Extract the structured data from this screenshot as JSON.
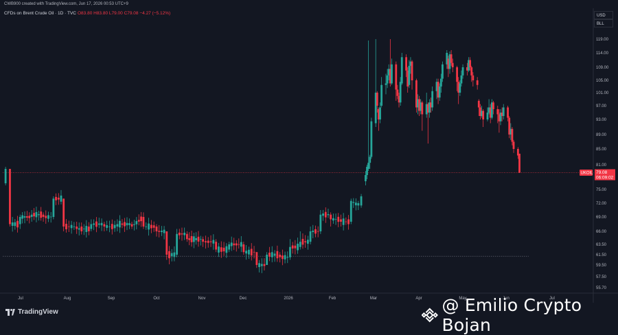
{
  "header": {
    "created_by": "CWB900 created with TradingView.com, Jun 17, 2026 00:53 UTC+9"
  },
  "legend": {
    "symbol": "CFDs on Brent Crude Oil · 1D · TVC",
    "ohlc_text": "O83.80 H83.80 L79.00 C79.08 −4.27 (−5.12%)"
  },
  "price_axis": {
    "currency": "USD",
    "unit": "BLL",
    "last_label": "UKOIL",
    "last_price": "79.08",
    "countdown": "06:09:02"
  },
  "footer": {
    "brand": "TradingView",
    "watermark": "@ Emilio Crypto Bojan"
  },
  "colors": {
    "background": "#131722",
    "up": "#26a69a",
    "down": "#f23645",
    "price_line": "#f23645"
  },
  "chart_data": {
    "type": "candlestick",
    "title": "CFDs on Brent Crude Oil · 1D · TVC",
    "y_ticks": [
      "119.00",
      "114.00",
      "109.00",
      "105.00",
      "101.00",
      "97.00",
      "93.00",
      "89.00",
      "85.00",
      "81.00",
      "75.00",
      "72.00",
      "69.00",
      "66.00",
      "63.50",
      "61.50",
      "59.50",
      "57.50",
      "55.70"
    ],
    "x_ticks": [
      "Jul",
      "Aug",
      "Sep",
      "Oct",
      "Nov",
      "Dec",
      "2026",
      "Feb",
      "Mar",
      "Apr",
      "May",
      "Jun",
      "Jul"
    ],
    "ylim": [
      55.7,
      119
    ],
    "horizontal_line": 61.2,
    "last_price": 79.08,
    "grid": false,
    "candles": [
      {
        "d": "2025-06-27",
        "c": 80.0,
        "o": 76.5,
        "h": 80.5,
        "l": 76.0
      },
      {
        "d": "2025-06-30",
        "c": 67.5,
        "o": 80.0,
        "h": 80.0,
        "l": 67.0
      },
      {
        "d": "2025-07-07",
        "c": 69.0,
        "o": 67.5,
        "h": 69.5,
        "l": 66.5
      },
      {
        "d": "2025-07-15",
        "c": 69.5,
        "o": 69.0,
        "h": 70.5,
        "l": 68.0
      },
      {
        "d": "2025-07-23",
        "c": 69.0,
        "o": 69.5,
        "h": 70.0,
        "l": 68.0
      },
      {
        "d": "2025-07-30",
        "c": 73.0,
        "o": 69.0,
        "h": 73.5,
        "l": 68.5
      },
      {
        "d": "2025-08-06",
        "c": 67.0,
        "o": 73.0,
        "h": 73.0,
        "l": 66.0
      },
      {
        "d": "2025-08-15",
        "c": 66.5,
        "o": 67.0,
        "h": 68.0,
        "l": 65.5
      },
      {
        "d": "2025-08-25",
        "c": 67.5,
        "o": 66.5,
        "h": 68.5,
        "l": 66.0
      },
      {
        "d": "2025-09-03",
        "c": 67.0,
        "o": 67.5,
        "h": 68.0,
        "l": 66.0
      },
      {
        "d": "2025-09-12",
        "c": 67.5,
        "o": 67.0,
        "h": 68.5,
        "l": 66.0
      },
      {
        "d": "2025-09-22",
        "c": 67.0,
        "o": 67.5,
        "h": 68.0,
        "l": 66.5
      },
      {
        "d": "2025-09-30",
        "c": 67.0,
        "o": 69.0,
        "h": 70.0,
        "l": 66.5
      },
      {
        "d": "2025-10-09",
        "c": 66.0,
        "o": 67.0,
        "h": 67.5,
        "l": 65.0
      },
      {
        "d": "2025-10-16",
        "c": 61.5,
        "o": 66.0,
        "h": 66.0,
        "l": 60.5
      },
      {
        "d": "2025-10-23",
        "c": 65.5,
        "o": 61.5,
        "h": 66.5,
        "l": 61.0
      },
      {
        "d": "2025-10-30",
        "c": 64.5,
        "o": 65.5,
        "h": 66.0,
        "l": 64.0
      },
      {
        "d": "2025-11-10",
        "c": 64.0,
        "o": 64.5,
        "h": 65.0,
        "l": 63.0
      },
      {
        "d": "2025-11-19",
        "c": 62.5,
        "o": 64.0,
        "h": 64.5,
        "l": 62.0
      },
      {
        "d": "2025-11-28",
        "c": 63.5,
        "o": 62.5,
        "h": 64.0,
        "l": 62.0
      },
      {
        "d": "2025-12-08",
        "c": 62.0,
        "o": 63.5,
        "h": 64.0,
        "l": 61.5
      },
      {
        "d": "2025-12-17",
        "c": 59.5,
        "o": 62.0,
        "h": 62.0,
        "l": 59.0
      },
      {
        "d": "2025-12-24",
        "c": 61.5,
        "o": 59.5,
        "h": 62.0,
        "l": 59.5
      },
      {
        "d": "2026-01-02",
        "c": 61.0,
        "o": 61.5,
        "h": 62.0,
        "l": 60.0
      },
      {
        "d": "2026-01-09",
        "c": 63.0,
        "o": 61.0,
        "h": 64.5,
        "l": 60.5
      },
      {
        "d": "2026-01-16",
        "c": 64.0,
        "o": 63.0,
        "h": 66.0,
        "l": 62.5
      },
      {
        "d": "2026-01-23",
        "c": 66.0,
        "o": 64.0,
        "h": 67.0,
        "l": 63.5
      },
      {
        "d": "2026-01-30",
        "c": 69.5,
        "o": 66.0,
        "h": 70.5,
        "l": 65.5
      },
      {
        "d": "2026-02-06",
        "c": 68.5,
        "o": 69.5,
        "h": 70.0,
        "l": 67.0
      },
      {
        "d": "2026-02-13",
        "c": 68.0,
        "o": 68.5,
        "h": 69.5,
        "l": 67.0
      },
      {
        "d": "2026-02-20",
        "c": 72.5,
        "o": 68.0,
        "h": 73.0,
        "l": 67.5
      },
      {
        "d": "2026-02-25",
        "c": 72.0,
        "o": 71.5,
        "h": 72.5,
        "l": 70.5
      },
      {
        "d": "2026-02-27",
        "c": 73.5,
        "o": 71.5,
        "h": 74.0,
        "l": 71.0
      },
      {
        "d": "2026-03-02",
        "c": 78.5,
        "o": 77.0,
        "h": 79.5,
        "l": 76.0
      },
      {
        "d": "2026-03-03",
        "c": 80.5,
        "o": 78.5,
        "h": 81.0,
        "l": 77.5
      },
      {
        "d": "2026-03-04",
        "c": 81.5,
        "o": 80.0,
        "h": 118.5,
        "l": 79.5
      },
      {
        "d": "2026-03-05",
        "c": 83.0,
        "o": 81.5,
        "h": 83.5,
        "l": 80.0
      },
      {
        "d": "2026-03-06",
        "c": 92.5,
        "o": 83.0,
        "h": 93.5,
        "l": 82.5
      },
      {
        "d": "2026-03-09",
        "c": 101.0,
        "o": 92.0,
        "h": 119.0,
        "l": 91.0
      },
      {
        "d": "2026-03-10",
        "c": 97.0,
        "o": 101.0,
        "h": 101.5,
        "l": 95.0
      },
      {
        "d": "2026-03-11",
        "c": 93.0,
        "o": 96.0,
        "h": 96.5,
        "l": 90.0
      },
      {
        "d": "2026-03-12",
        "c": 96.5,
        "o": 93.0,
        "h": 98.0,
        "l": 92.0
      },
      {
        "d": "2026-03-13",
        "c": 103.5,
        "o": 97.0,
        "h": 106.0,
        "l": 96.5
      },
      {
        "d": "2026-03-16",
        "c": 104.0,
        "o": 103.5,
        "h": 107.0,
        "l": 100.5
      },
      {
        "d": "2026-03-17",
        "c": 106.5,
        "o": 104.0,
        "h": 108.5,
        "l": 102.5
      },
      {
        "d": "2026-03-18",
        "c": 108.5,
        "o": 106.5,
        "h": 110.0,
        "l": 105.0
      },
      {
        "d": "2026-03-19",
        "c": 104.0,
        "o": 108.5,
        "h": 119.0,
        "l": 103.0
      },
      {
        "d": "2026-03-20",
        "c": 110.0,
        "o": 104.0,
        "h": 112.0,
        "l": 103.5
      },
      {
        "d": "2026-03-23",
        "c": 102.0,
        "o": 110.0,
        "h": 111.0,
        "l": 98.5
      },
      {
        "d": "2026-03-24",
        "c": 100.0,
        "o": 102.0,
        "h": 103.5,
        "l": 99.0
      },
      {
        "d": "2026-03-25",
        "c": 98.0,
        "o": 100.0,
        "h": 101.0,
        "l": 96.5
      },
      {
        "d": "2026-03-26",
        "c": 104.5,
        "o": 98.0,
        "h": 106.0,
        "l": 97.0
      },
      {
        "d": "2026-03-27",
        "c": 112.5,
        "o": 104.0,
        "h": 114.0,
        "l": 103.5
      },
      {
        "d": "2026-03-30",
        "c": 108.0,
        "o": 112.5,
        "h": 113.5,
        "l": 106.0
      },
      {
        "d": "2026-03-31",
        "c": 103.0,
        "o": 108.0,
        "h": 109.0,
        "l": 101.0
      },
      {
        "d": "2026-04-01",
        "c": 109.5,
        "o": 103.5,
        "h": 111.5,
        "l": 102.5
      },
      {
        "d": "2026-04-02",
        "c": 111.0,
        "o": 109.5,
        "h": 112.5,
        "l": 107.0
      },
      {
        "d": "2026-04-03",
        "c": 105.0,
        "o": 111.0,
        "h": 111.5,
        "l": 102.0
      },
      {
        "d": "2026-04-06",
        "c": 96.5,
        "o": 105.0,
        "h": 105.5,
        "l": 95.0
      },
      {
        "d": "2026-04-07",
        "c": 99.0,
        "o": 96.5,
        "h": 100.5,
        "l": 94.5
      },
      {
        "d": "2026-04-08",
        "c": 95.5,
        "o": 99.0,
        "h": 100.0,
        "l": 94.0
      },
      {
        "d": "2026-04-09",
        "c": 98.0,
        "o": 95.5,
        "h": 99.0,
        "l": 94.5
      },
      {
        "d": "2026-04-10",
        "c": 94.5,
        "o": 98.0,
        "h": 98.5,
        "l": 90.0
      },
      {
        "d": "2026-04-13",
        "c": 97.5,
        "o": 94.5,
        "h": 101.0,
        "l": 93.5
      },
      {
        "d": "2026-04-14",
        "c": 95.0,
        "o": 97.5,
        "h": 98.0,
        "l": 86.5
      },
      {
        "d": "2026-04-15",
        "c": 98.0,
        "o": 95.0,
        "h": 99.0,
        "l": 93.5
      },
      {
        "d": "2026-04-16",
        "c": 96.5,
        "o": 98.0,
        "h": 99.5,
        "l": 95.0
      },
      {
        "d": "2026-04-17",
        "c": 101.5,
        "o": 96.5,
        "h": 103.0,
        "l": 95.5
      },
      {
        "d": "2026-04-20",
        "c": 104.5,
        "o": 101.5,
        "h": 105.5,
        "l": 99.0
      },
      {
        "d": "2026-04-21",
        "c": 99.5,
        "o": 104.5,
        "h": 105.5,
        "l": 97.5
      },
      {
        "d": "2026-04-22",
        "c": 103.0,
        "o": 99.5,
        "h": 104.0,
        "l": 98.5
      },
      {
        "d": "2026-04-23",
        "c": 105.5,
        "o": 103.0,
        "h": 107.0,
        "l": 101.0
      },
      {
        "d": "2026-04-24",
        "c": 110.0,
        "o": 105.5,
        "h": 111.0,
        "l": 104.5
      },
      {
        "d": "2026-04-27",
        "c": 114.0,
        "o": 110.0,
        "h": 115.0,
        "l": 108.5
      },
      {
        "d": "2026-04-28",
        "c": 108.5,
        "o": 112.0,
        "h": 113.0,
        "l": 106.0
      },
      {
        "d": "2026-04-29",
        "c": 113.5,
        "o": 108.5,
        "h": 114.5,
        "l": 107.0
      },
      {
        "d": "2026-04-30",
        "c": 110.5,
        "o": 113.5,
        "h": 115.0,
        "l": 109.5
      },
      {
        "d": "2026-05-01",
        "c": 109.0,
        "o": 110.5,
        "h": 112.0,
        "l": 107.5
      },
      {
        "d": "2026-05-04",
        "c": 104.5,
        "o": 109.0,
        "h": 109.5,
        "l": 101.5
      },
      {
        "d": "2026-05-05",
        "c": 101.0,
        "o": 104.5,
        "h": 106.0,
        "l": 97.5
      },
      {
        "d": "2026-05-06",
        "c": 104.0,
        "o": 101.0,
        "h": 105.0,
        "l": 100.0
      },
      {
        "d": "2026-05-07",
        "c": 106.5,
        "o": 104.0,
        "h": 108.0,
        "l": 103.0
      },
      {
        "d": "2026-05-08",
        "c": 109.0,
        "o": 106.5,
        "h": 110.0,
        "l": 105.5
      },
      {
        "d": "2026-05-11",
        "c": 108.0,
        "o": 109.0,
        "h": 110.5,
        "l": 106.5
      },
      {
        "d": "2026-05-12",
        "c": 111.5,
        "o": 108.0,
        "h": 112.5,
        "l": 107.5
      },
      {
        "d": "2026-05-13",
        "c": 109.0,
        "o": 111.5,
        "h": 112.5,
        "l": 108.0
      },
      {
        "d": "2026-05-14",
        "c": 106.5,
        "o": 109.0,
        "h": 109.5,
        "l": 104.5
      },
      {
        "d": "2026-05-15",
        "c": 105.0,
        "o": 106.5,
        "h": 107.5,
        "l": 103.0
      },
      {
        "d": "2026-05-18",
        "c": 103.5,
        "o": 105.0,
        "h": 106.0,
        "l": 102.0
      },
      {
        "d": "2026-05-19",
        "c": 96.5,
        "o": 98.5,
        "h": 99.0,
        "l": 94.0
      },
      {
        "d": "2026-05-20",
        "c": 94.0,
        "o": 96.5,
        "h": 97.5,
        "l": 93.0
      },
      {
        "d": "2026-05-21",
        "c": 95.5,
        "o": 94.0,
        "h": 97.0,
        "l": 93.5
      },
      {
        "d": "2026-05-22",
        "c": 93.0,
        "o": 95.5,
        "h": 96.0,
        "l": 91.0
      },
      {
        "d": "2026-05-25",
        "c": 95.0,
        "o": 93.0,
        "h": 96.5,
        "l": 92.5
      },
      {
        "d": "2026-05-26",
        "c": 96.5,
        "o": 95.0,
        "h": 99.0,
        "l": 94.5
      },
      {
        "d": "2026-05-27",
        "c": 93.5,
        "o": 96.5,
        "h": 97.5,
        "l": 92.0
      },
      {
        "d": "2026-05-28",
        "c": 98.0,
        "o": 93.5,
        "h": 99.0,
        "l": 93.0
      },
      {
        "d": "2026-05-29",
        "c": 96.0,
        "o": 98.0,
        "h": 98.5,
        "l": 94.5
      },
      {
        "d": "2026-06-01",
        "c": 94.5,
        "o": 96.0,
        "h": 97.0,
        "l": 92.0
      },
      {
        "d": "2026-06-02",
        "c": 92.5,
        "o": 94.5,
        "h": 96.0,
        "l": 89.5
      },
      {
        "d": "2026-06-03",
        "c": 95.0,
        "o": 92.5,
        "h": 96.0,
        "l": 91.5
      },
      {
        "d": "2026-06-04",
        "c": 94.0,
        "o": 95.0,
        "h": 96.5,
        "l": 92.5
      },
      {
        "d": "2026-06-05",
        "c": 96.5,
        "o": 94.0,
        "h": 97.5,
        "l": 93.0
      },
      {
        "d": "2026-06-08",
        "c": 93.5,
        "o": 96.5,
        "h": 97.0,
        "l": 92.5
      },
      {
        "d": "2026-06-09",
        "c": 89.0,
        "o": 93.5,
        "h": 94.0,
        "l": 88.0
      },
      {
        "d": "2026-06-10",
        "c": 90.5,
        "o": 89.0,
        "h": 92.0,
        "l": 87.5
      },
      {
        "d": "2026-06-11",
        "c": 87.0,
        "o": 90.5,
        "h": 91.0,
        "l": 86.0
      },
      {
        "d": "2026-06-12",
        "c": 85.0,
        "o": 87.0,
        "h": 87.5,
        "l": 84.0
      },
      {
        "d": "2026-06-15",
        "c": 83.35,
        "o": 85.0,
        "h": 85.5,
        "l": 82.5
      },
      {
        "d": "2026-06-16",
        "c": 79.08,
        "o": 83.8,
        "h": 83.8,
        "l": 79.0
      }
    ]
  }
}
